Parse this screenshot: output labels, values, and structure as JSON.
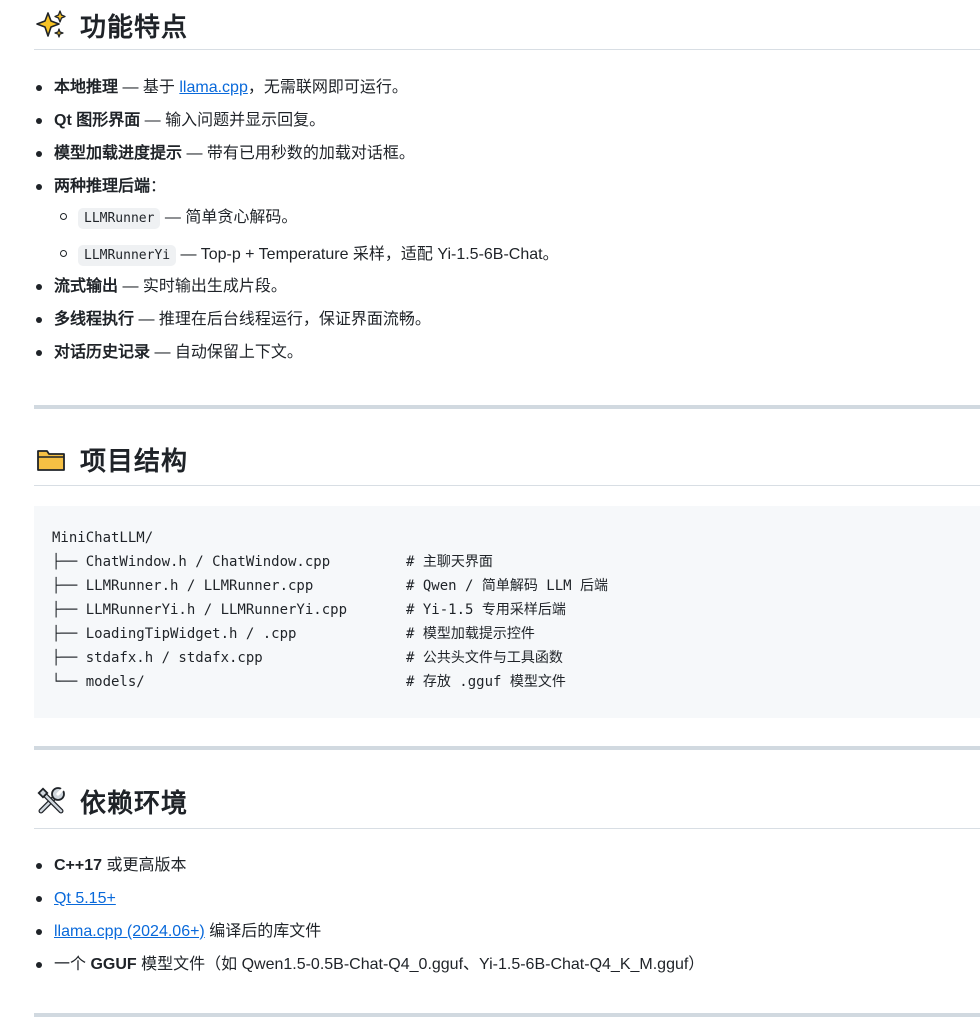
{
  "features": {
    "heading": "功能特点",
    "items": [
      {
        "strong": "本地推理",
        "text_before": " — 基于 ",
        "link": "llama.cpp",
        "text_after": "，无需联网即可运行。"
      },
      {
        "strong": "Qt 图形界面",
        "text": " — 输入问题并显示回复。"
      },
      {
        "strong": "模型加载进度提示",
        "text": " — 带有已用秒数的加载对话框。"
      },
      {
        "strong": "两种推理后端",
        "text": "：",
        "sub": [
          {
            "code": "LLMRunner",
            "text": " — 简单贪心解码。"
          },
          {
            "code": "LLMRunnerYi",
            "text": " — Top-p + Temperature 采样，适配 Yi-1.5-6B-Chat。"
          }
        ]
      },
      {
        "strong": "流式输出",
        "text": " — 实时输出生成片段。"
      },
      {
        "strong": "多线程执行",
        "text": " — 推理在后台线程运行，保证界面流畅。"
      },
      {
        "strong": "对话历史记录",
        "text": " — 自动保留上下文。"
      }
    ]
  },
  "structure": {
    "heading": "项目结构",
    "lines": [
      {
        "path": "MiniChatLLM/",
        "comment": ""
      },
      {
        "path": "├── ChatWindow.h / ChatWindow.cpp",
        "comment": "# 主聊天界面"
      },
      {
        "path": "├── LLMRunner.h / LLMRunner.cpp",
        "comment": "# Qwen / 简单解码 LLM 后端"
      },
      {
        "path": "├── LLMRunnerYi.h / LLMRunnerYi.cpp",
        "comment": "# Yi-1.5 专用采样后端"
      },
      {
        "path": "├── LoadingTipWidget.h / .cpp",
        "comment": "# 模型加载提示控件"
      },
      {
        "path": "├── stdafx.h / stdafx.cpp",
        "comment": "# 公共头文件与工具函数"
      },
      {
        "path": "└── models/",
        "comment": "# 存放 .gguf 模型文件"
      }
    ]
  },
  "deps": {
    "heading": "依赖环境",
    "items": [
      {
        "strong": "C++17",
        "text": " 或更高版本"
      },
      {
        "link": "Qt 5.15+"
      },
      {
        "link": "llama.cpp (2024.06+)",
        "text": " 编译后的库文件"
      },
      {
        "text_before": "一个 ",
        "strong": "GGUF",
        "text": " 模型文件（如 Qwen1.5-0.5B-Chat-Q4_0.gguf、Yi-1.5-6B-Chat-Q4_K_M.gguf）"
      }
    ]
  },
  "colors": {
    "link": "#0969da",
    "text": "#1f2328",
    "code_bg": "#eff1f3",
    "pre_bg": "#f6f8fa"
  },
  "icons": [
    "sparkles-icon",
    "folder-icon",
    "tools-icon"
  ]
}
